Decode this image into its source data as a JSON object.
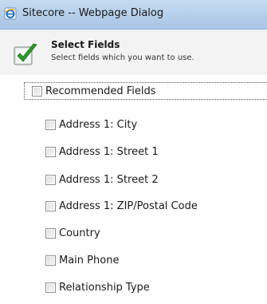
{
  "window": {
    "title": "Sitecore -- Webpage Dialog"
  },
  "header": {
    "title": "Select Fields",
    "subtitle": "Select fields which you want to use."
  },
  "fields": {
    "recommended": {
      "label": "Recommended Fields",
      "checked": false
    },
    "items": [
      {
        "label": "Address 1: City",
        "checked": false
      },
      {
        "label": "Address 1: Street 1",
        "checked": false
      },
      {
        "label": "Address 1: Street 2",
        "checked": false
      },
      {
        "label": "Address 1: ZIP/Postal Code",
        "checked": false
      },
      {
        "label": "Country",
        "checked": false
      },
      {
        "label": "Main Phone",
        "checked": false
      },
      {
        "label": "Relationship Type",
        "checked": false
      }
    ]
  },
  "colors": {
    "titlebar": "#b3cde9",
    "header_bg": "#f3f3f3",
    "accent_check": "#2e9a2e"
  }
}
